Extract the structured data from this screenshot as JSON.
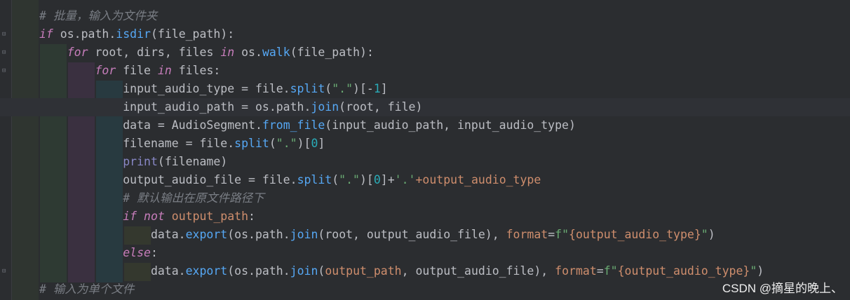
{
  "editor": {
    "colors": {
      "background": "#2b2d30",
      "keyword": "#cf8e6d",
      "function": "#56a8f5",
      "builtin": "#8888c6",
      "string": "#6aab73",
      "number": "#2aacb8",
      "comment": "#7a7e85"
    },
    "lines": [
      {
        "t": [
          [
            "# 批量，输入为文件夹",
            "cmt"
          ]
        ]
      },
      {
        "t": [
          [
            "if",
            "kwp"
          ],
          [
            " os.path.",
            "tx"
          ],
          [
            "isdir",
            "fn"
          ],
          [
            "(file_path):",
            "tx"
          ]
        ]
      },
      {
        "t": [
          [
            "    ",
            "tx"
          ],
          [
            "for",
            "kwp"
          ],
          [
            " root, dirs, files ",
            "tx"
          ],
          [
            "in",
            "kwp"
          ],
          [
            " os.",
            "tx"
          ],
          [
            "walk",
            "fn"
          ],
          [
            "(file_path):",
            "tx"
          ]
        ]
      },
      {
        "t": [
          [
            "        ",
            "tx"
          ],
          [
            "for",
            "kwp"
          ],
          [
            " file ",
            "tx"
          ],
          [
            "in",
            "kwp"
          ],
          [
            " files:",
            "tx"
          ]
        ]
      },
      {
        "t": [
          [
            "            input_audio_type = file.",
            "tx"
          ],
          [
            "split",
            "fn"
          ],
          [
            "(",
            "tx"
          ],
          [
            "\".\"",
            "str"
          ],
          [
            ")[-",
            "tx"
          ],
          [
            "1",
            "num"
          ],
          [
            "]",
            "tx"
          ]
        ]
      },
      {
        "t": [
          [
            "            input_audio_path = os.path.",
            "tx"
          ],
          [
            "join",
            "fn"
          ],
          [
            "(root, file)",
            "tx"
          ]
        ]
      },
      {
        "t": [
          [
            "            data = AudioSegment.",
            "tx"
          ],
          [
            "from_file",
            "fn"
          ],
          [
            "(input_audio_path, input_audio_type)",
            "tx"
          ]
        ]
      },
      {
        "t": [
          [
            "            filename = file.",
            "tx"
          ],
          [
            "split",
            "fn"
          ],
          [
            "(",
            "tx"
          ],
          [
            "\".\"",
            "str"
          ],
          [
            ")[",
            "tx"
          ],
          [
            "0",
            "num"
          ],
          [
            "]",
            "tx"
          ]
        ]
      },
      {
        "t": [
          [
            "            ",
            "tx"
          ],
          [
            "print",
            "bi"
          ],
          [
            "(filename)",
            "tx"
          ]
        ]
      },
      {
        "t": [
          [
            "            output_audio_file = file.",
            "tx"
          ],
          [
            "split",
            "fn"
          ],
          [
            "(",
            "tx"
          ],
          [
            "\".\"",
            "str"
          ],
          [
            ")[",
            "tx"
          ],
          [
            "0",
            "num"
          ],
          [
            "]+",
            "tx"
          ],
          [
            "'.'",
            "str"
          ],
          [
            "+output_audio_type",
            "pm"
          ]
        ]
      },
      {
        "t": [
          [
            "            ",
            "tx"
          ],
          [
            "# 默认输出在原文件路径下",
            "cmt"
          ]
        ]
      },
      {
        "t": [
          [
            "            ",
            "tx"
          ],
          [
            "if not",
            "kwp"
          ],
          [
            " ",
            "tx"
          ],
          [
            "output_path",
            "pm"
          ],
          [
            ":",
            "tx"
          ]
        ]
      },
      {
        "t": [
          [
            "                data.",
            "tx"
          ],
          [
            "export",
            "fn"
          ],
          [
            "(os.path.",
            "tx"
          ],
          [
            "join",
            "fn"
          ],
          [
            "(root, output_audio_file), ",
            "tx"
          ],
          [
            "format",
            "fs"
          ],
          [
            "=",
            "tx"
          ],
          [
            "f\"",
            "str"
          ],
          [
            "{output_audio_type}",
            "pm"
          ],
          [
            "\"",
            "str"
          ],
          [
            ")",
            "tx"
          ]
        ]
      },
      {
        "t": [
          [
            "            ",
            "tx"
          ],
          [
            "else",
            "kwp"
          ],
          [
            ":",
            "tx"
          ]
        ]
      },
      {
        "t": [
          [
            "                data.",
            "tx"
          ],
          [
            "export",
            "fn"
          ],
          [
            "(os.path.",
            "tx"
          ],
          [
            "join",
            "fn"
          ],
          [
            "(",
            "tx"
          ],
          [
            "output_path",
            "pm"
          ],
          [
            ", output_audio_file), ",
            "tx"
          ],
          [
            "format",
            "fs"
          ],
          [
            "=",
            "tx"
          ],
          [
            "f\"",
            "str"
          ],
          [
            "{output_audio_type}",
            "pm"
          ],
          [
            "\"",
            "str"
          ],
          [
            ")",
            "tx"
          ]
        ]
      },
      {
        "t": [
          [
            "# 输入为单个文件",
            "cmt"
          ]
        ]
      }
    ]
  },
  "watermark": "CSDN @摘星的晚上、"
}
